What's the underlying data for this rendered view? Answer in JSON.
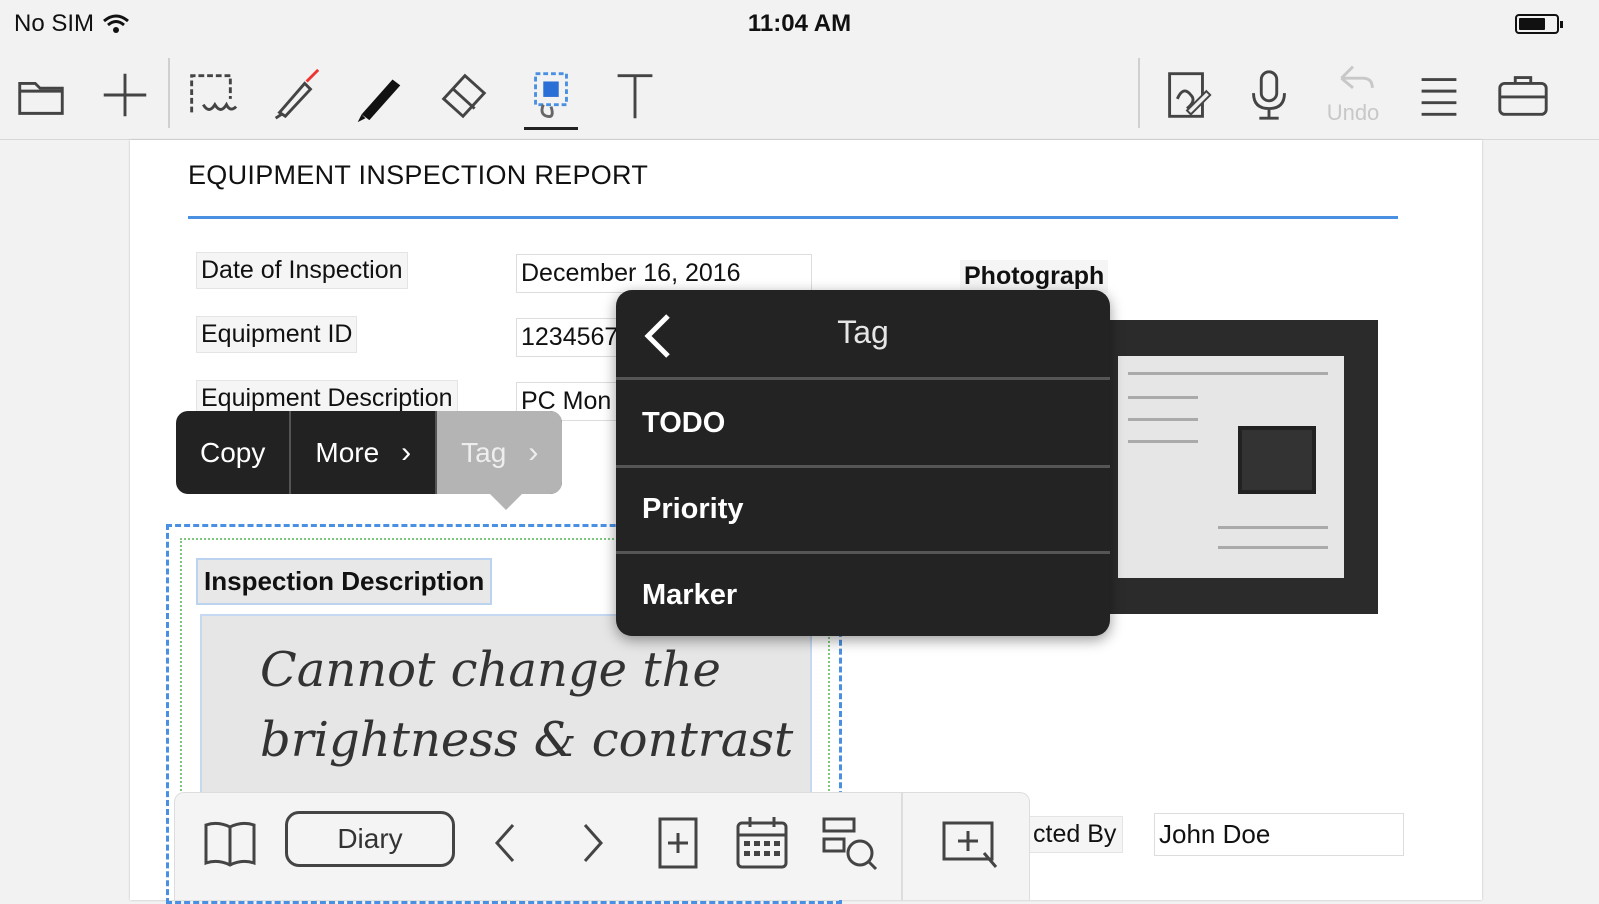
{
  "status_bar": {
    "carrier": "No SIM",
    "time": "11:04 AM"
  },
  "toolbar": {
    "left_icons": [
      "folder-icon",
      "plus-icon",
      "lasso-select-icon",
      "highlighter-icon",
      "pen-icon",
      "eraser-icon",
      "shape-select-icon",
      "text-icon"
    ],
    "right_icons": [
      "handwriting-convert-icon",
      "microphone-icon",
      "undo-icon",
      "list-menu-icon",
      "toolbox-icon"
    ],
    "undo_label": "Undo"
  },
  "document": {
    "title": "EQUIPMENT INSPECTION REPORT",
    "fields": [
      {
        "label": "Date of Inspection",
        "value": "December 16, 2016"
      },
      {
        "label": "Equipment ID",
        "value": "1234567"
      },
      {
        "label": "Equipment Description",
        "value": "PC Mon"
      }
    ],
    "photograph_label": "Photograph",
    "inspection_description_label": "Inspection Description",
    "handwriting": [
      "Cannot change the",
      "brightness & contrast"
    ],
    "inspected_by_label": "cted By",
    "inspected_by_value": "John Doe"
  },
  "context_menu": {
    "items": [
      {
        "label": "Copy"
      },
      {
        "label": "More",
        "chevron": "›"
      },
      {
        "label": "Tag",
        "chevron": "›",
        "highlighted": true
      }
    ]
  },
  "tag_submenu": {
    "title": "Tag",
    "items": [
      "TODO",
      "Priority",
      "Marker"
    ]
  },
  "bottom_bar": {
    "diary_label": "Diary",
    "icons": [
      "book-icon",
      "prev-page-icon",
      "next-page-icon",
      "add-page-icon",
      "calendar-icon",
      "search-list-icon",
      "zoom-box-icon"
    ]
  },
  "colors": {
    "accent_blue": "#4a90e2",
    "menu_dark": "#232323",
    "menu_highlight": "#b4b4b4"
  }
}
